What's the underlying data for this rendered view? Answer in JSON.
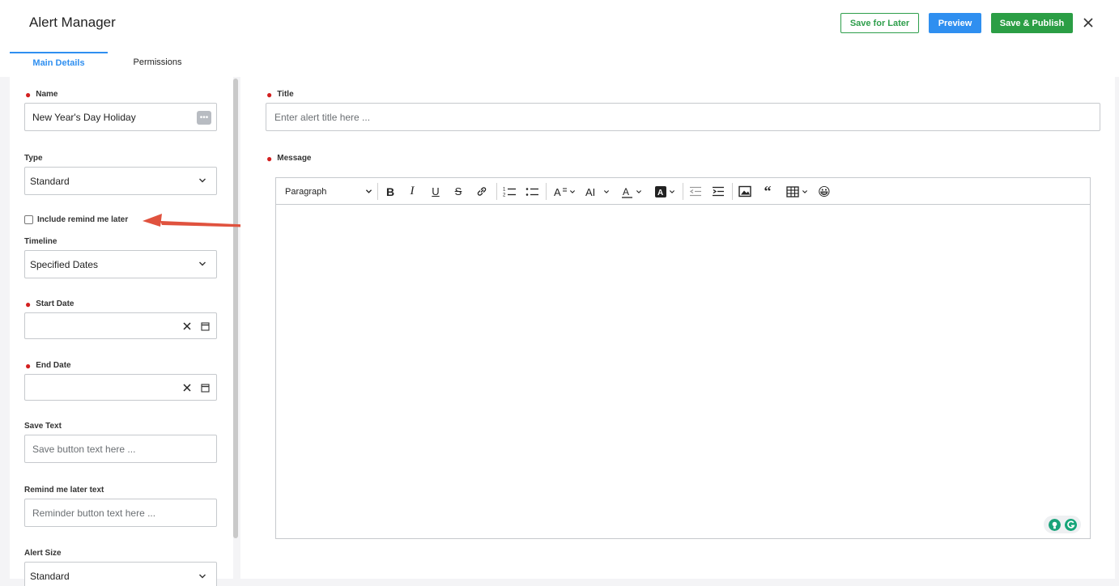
{
  "app": {
    "title": "Alert Manager"
  },
  "header": {
    "save_later_label": "Save for Later",
    "preview_label": "Preview",
    "publish_label": "Save & Publish"
  },
  "tabs": [
    {
      "label": "Main Details",
      "active": true
    },
    {
      "label": "Permissions",
      "active": false
    }
  ],
  "form": {
    "name": {
      "label": "Name",
      "value": "New Year's Day Holiday"
    },
    "type": {
      "label": "Type",
      "value": "Standard"
    },
    "remind_checkbox": {
      "label": "Include remind me later",
      "checked": false
    },
    "timeline": {
      "label": "Timeline",
      "value": "Specified Dates"
    },
    "start_date": {
      "label": "Start Date",
      "value": ""
    },
    "end_date": {
      "label": "End Date",
      "value": ""
    },
    "save_text": {
      "label": "Save Text",
      "placeholder": "Save button text here ..."
    },
    "remind_text": {
      "label": "Remind me later text",
      "placeholder": "Reminder button text here ..."
    },
    "alert_size": {
      "label": "Alert Size",
      "value": "Standard"
    }
  },
  "content": {
    "title": {
      "label": "Title",
      "placeholder": "Enter alert title here ..."
    },
    "message": {
      "label": "Message"
    },
    "toolbar": {
      "paragraph_label": "Paragraph",
      "emoji": "😀"
    }
  },
  "colors": {
    "accent_blue": "#2f8ff0",
    "green": "#2b9e45",
    "required_red": "#d32020",
    "annotation_arrow": "#e0523e"
  }
}
